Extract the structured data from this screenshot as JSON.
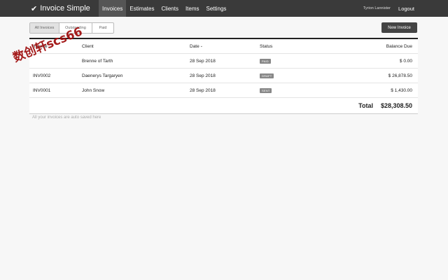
{
  "app": {
    "brand": "Invoice Simple",
    "nav": [
      "Invoices",
      "Estimates",
      "Clients",
      "Items",
      "Settings"
    ],
    "user": "Tyrion Lannister",
    "logout": "Logout"
  },
  "filters": [
    "All Invoices",
    "Outstanding",
    "Paid"
  ],
  "new_invoice_label": "New Invoice",
  "table": {
    "headers": {
      "invoice": "Invoice",
      "client": "Client",
      "date": "Date",
      "status": "Status",
      "balance": "Balance Due"
    },
    "rows": [
      {
        "invoice": "",
        "client": "Brenne of Tarth",
        "date": "28 Sep 2018",
        "status": "PAID",
        "balance": "$ 0.00"
      },
      {
        "invoice": "INV0002",
        "client": "Daenerys Targaryen",
        "date": "28 Sep 2018",
        "status": "DRAFT",
        "balance": "$ 26,878.50"
      },
      {
        "invoice": "INV0001",
        "client": "John Snow",
        "date": "28 Sep 2018",
        "status": "SENT",
        "balance": "$ 1,430.00"
      }
    ],
    "total_label": "Total",
    "total_value": "$28,308.50"
  },
  "autosave_note": "All your invoices are auto saved here",
  "watermark_text": "数创轩scs66",
  "colors": {
    "topbar": "#3a3a3a",
    "badge": "#888888",
    "watermark": "#a01010"
  }
}
